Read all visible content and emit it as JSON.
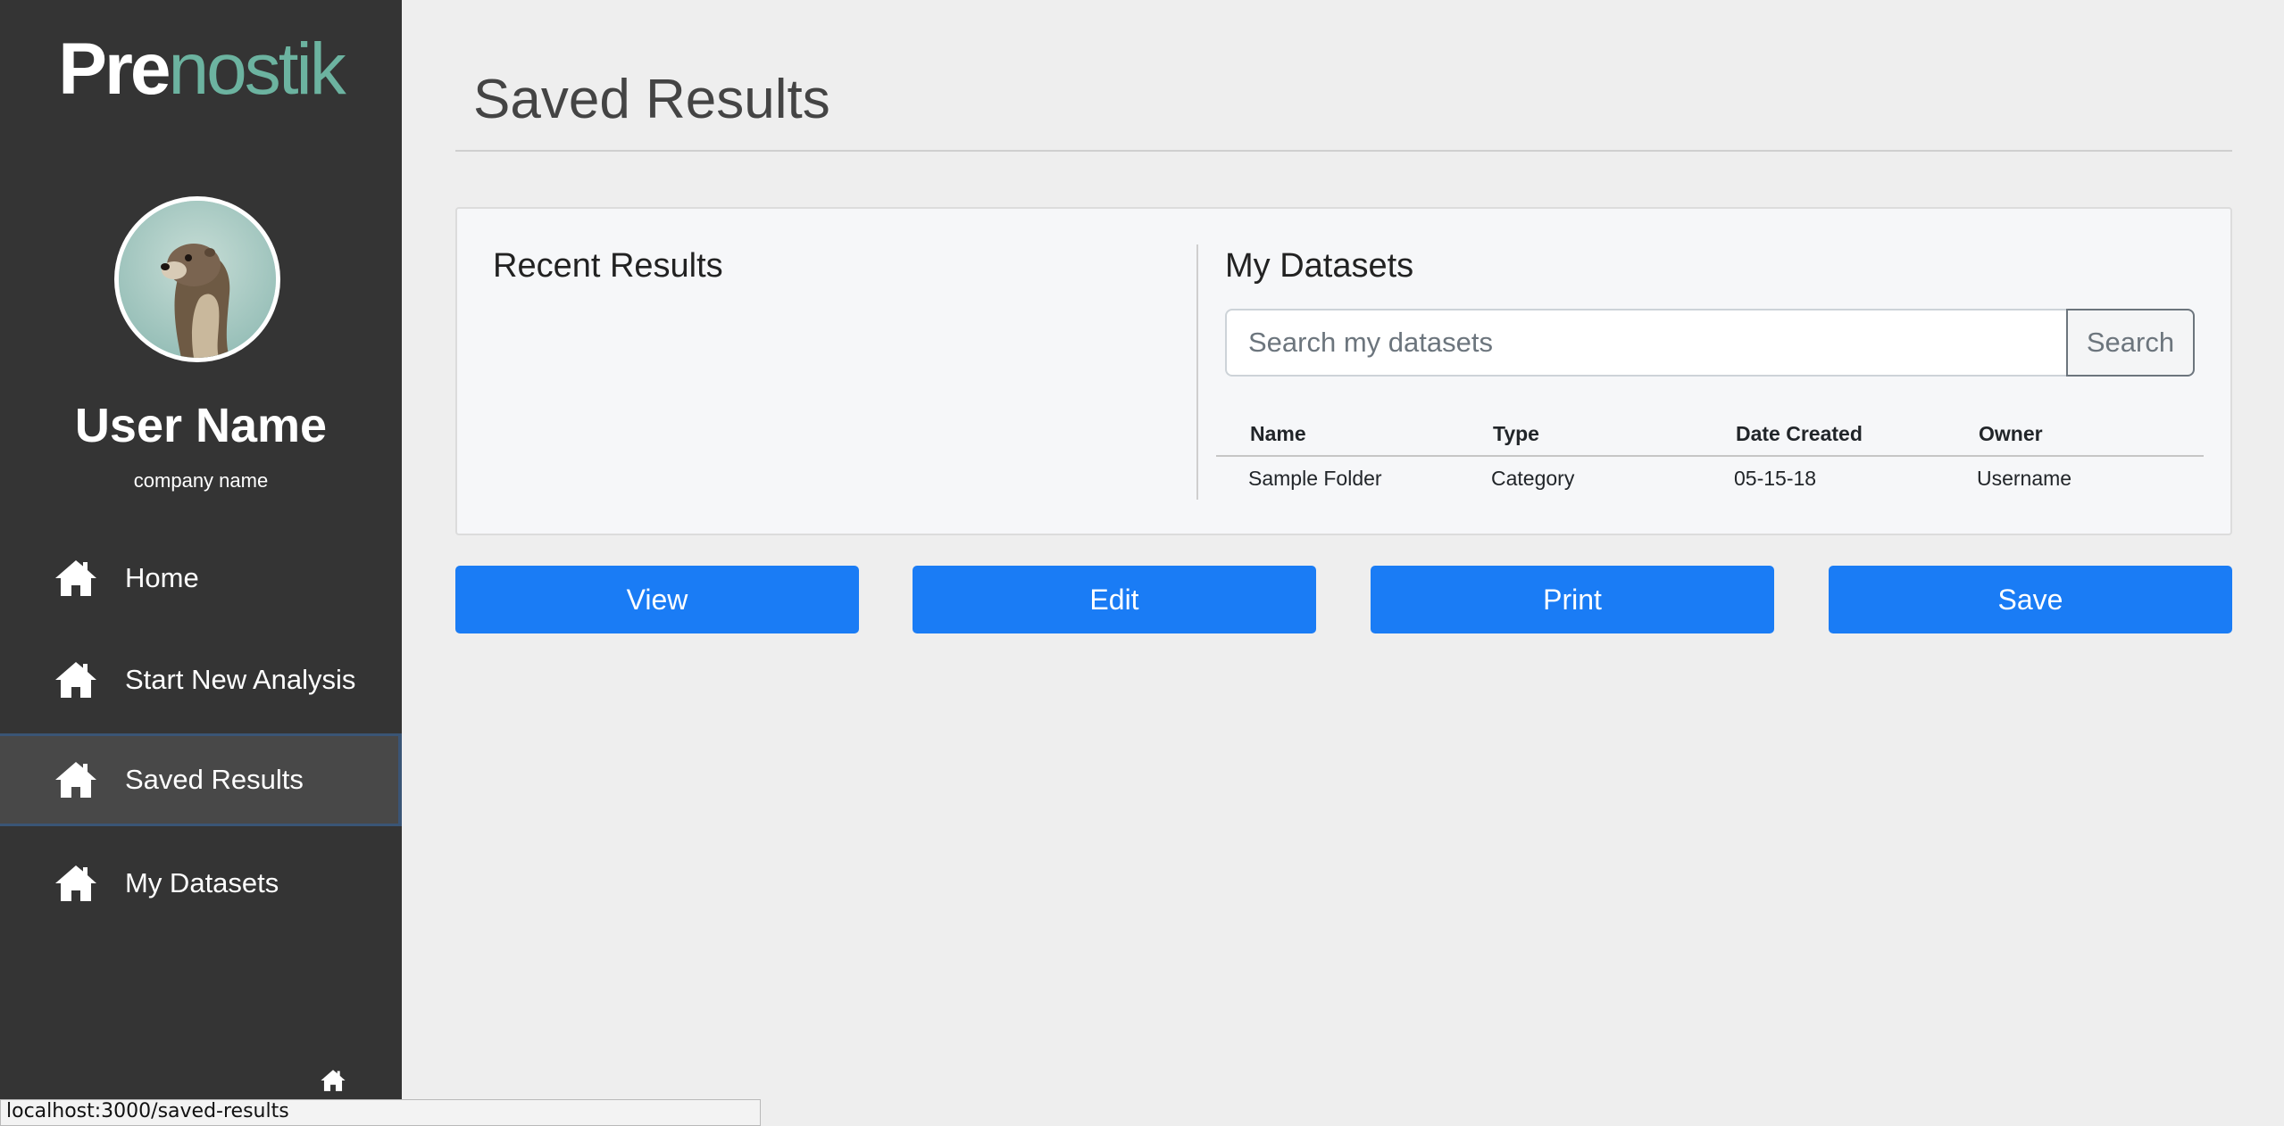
{
  "brand": {
    "part1": "Pre",
    "part2": "nostik",
    "accent": "#6cb3a0"
  },
  "user": {
    "name": "User Name",
    "company": "company name",
    "avatar_icon": "otter-avatar"
  },
  "nav": {
    "items": [
      {
        "label": "Home",
        "icon": "home-icon",
        "active": false
      },
      {
        "label": "Start New Analysis",
        "icon": "home-icon",
        "active": false
      },
      {
        "label": "Saved Results",
        "icon": "home-icon",
        "active": true
      },
      {
        "label": "My Datasets",
        "icon": "home-icon",
        "active": false
      }
    ]
  },
  "page": {
    "title": "Saved Results"
  },
  "recent": {
    "heading": "Recent Results"
  },
  "datasets": {
    "heading": "My Datasets",
    "search_placeholder": "Search my datasets",
    "search_label": "Search",
    "columns": [
      "Name",
      "Type",
      "Date Created",
      "Owner"
    ],
    "rows": [
      [
        "Sample Folder",
        "Category",
        "05-15-18",
        "Username"
      ]
    ]
  },
  "actions": {
    "view": "View",
    "edit": "Edit",
    "print": "Print",
    "save": "Save"
  },
  "status_bar": {
    "url": "localhost:3000/saved-results"
  },
  "colors": {
    "sidebar": "#343434",
    "primary_button": "#1a7cf5"
  }
}
